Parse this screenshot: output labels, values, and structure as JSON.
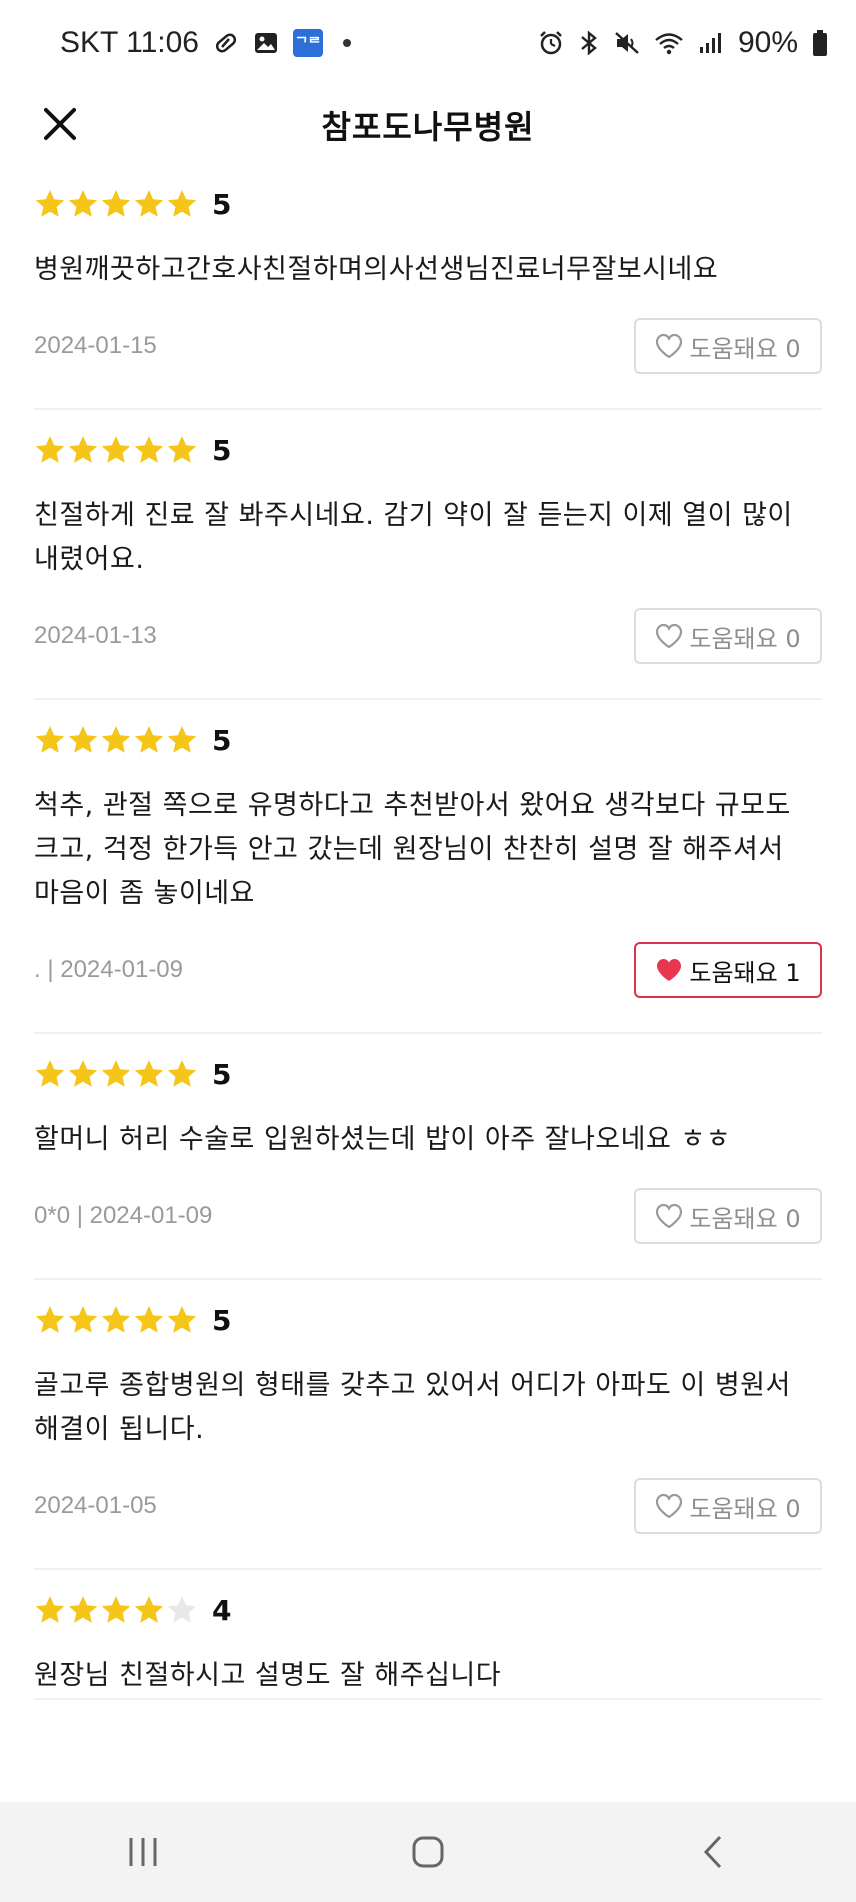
{
  "status_bar": {
    "carrier_time": "SKT 11:06",
    "badge": "ᄀᄅ",
    "battery": "90%"
  },
  "header": {
    "title": "참포도나무병원"
  },
  "colors": {
    "star": "#f5c518",
    "star_empty": "#e8e8e8",
    "heart_active": "#e8364e"
  },
  "reviews": [
    {
      "rating": 5,
      "score_label": "5",
      "text": "병원깨끗하고간호사친절하며의사선생님진료너무잘보시네요",
      "meta": "2024-01-15",
      "helpful_label": "도움돼요 0",
      "helpful_active": false
    },
    {
      "rating": 5,
      "score_label": "5",
      "text": "친절하게 진료 잘 봐주시네요. 감기 약이 잘 듣는지 이제 열이 많이 내렸어요.",
      "meta": "2024-01-13",
      "helpful_label": "도움돼요 0",
      "helpful_active": false
    },
    {
      "rating": 5,
      "score_label": "5",
      "text": "척추, 관절 쪽으로 유명하다고 추천받아서 왔어요 생각보다 규모도 크고, 걱정 한가득 안고 갔는데 원장님이 찬찬히 설명 잘 해주셔서 마음이 좀 놓이네요",
      "meta": ". | 2024-01-09",
      "helpful_label": "도움돼요 1",
      "helpful_active": true
    },
    {
      "rating": 5,
      "score_label": "5",
      "text": "할머니 허리 수술로 입원하셨는데 밥이 아주 잘나오네요 ㅎㅎ",
      "meta": "0*0 | 2024-01-09",
      "helpful_label": "도움돼요 0",
      "helpful_active": false
    },
    {
      "rating": 5,
      "score_label": "5",
      "text": "골고루 종합병원의 형태를 갖추고 있어서 어디가 아파도 이 병원서 해결이 됩니다.",
      "meta": "2024-01-05",
      "helpful_label": "도움돼요 0",
      "helpful_active": false
    },
    {
      "rating": 4,
      "score_label": "4",
      "text": "원장님 친절하시고 설명도 잘 해주십니다",
      "meta": "",
      "helpful_label": "",
      "helpful_active": false
    }
  ]
}
